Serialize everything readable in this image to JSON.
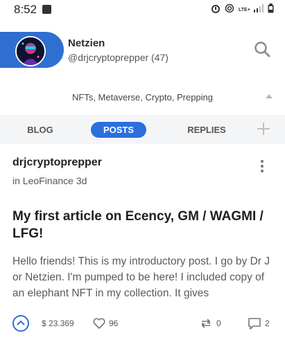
{
  "status_bar": {
    "time": "8:52",
    "lte_label": "LTE+"
  },
  "profile": {
    "display_name": "Netzien",
    "handle": "@drjcryptoprepper (47)",
    "accent_color": "#2f6fd1"
  },
  "tags": {
    "text": "NFTs, Metaverse, Crypto, Prepping"
  },
  "tabs": [
    {
      "label": "BLOG",
      "active": false
    },
    {
      "label": "POSTS",
      "active": true
    },
    {
      "label": "REPLIES",
      "active": false
    }
  ],
  "post": {
    "author": "drjcryptoprepper",
    "meta": "in LeoFinance 3d",
    "title": "My first article on Ecency, GM / WAGMI / LFG!",
    "body": "Hello friends! This is my introductory post. I go by Dr J or Netzien. I'm pumped to be here! I included copy of an elephant NFT in my collection. It gives",
    "payout": "$ 23.369",
    "likes": "96",
    "reblogs": "0",
    "comments": "2"
  },
  "icons": {
    "search": "search-icon",
    "add": "plus-icon",
    "menu": "more-vertical-icon",
    "vote": "upvote-chevron-icon",
    "likes": "heart-icon",
    "reblog": "reblog-icon",
    "comment": "comment-icon"
  }
}
